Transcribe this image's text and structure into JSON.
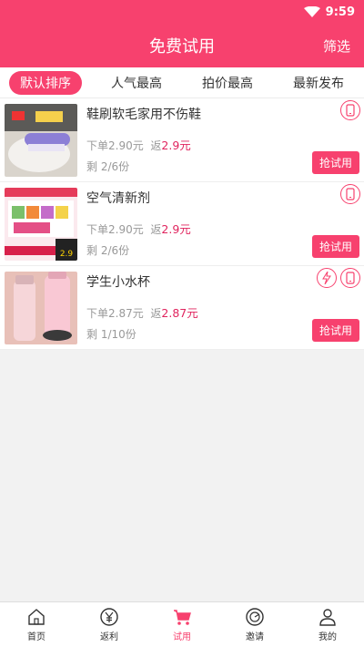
{
  "status": {
    "time": "9:59"
  },
  "header": {
    "title": "免费试用",
    "filter_label": "筛选"
  },
  "tabs": [
    {
      "label": "默认排序",
      "active": true
    },
    {
      "label": "人气最高",
      "active": false
    },
    {
      "label": "拍价最高",
      "active": false
    },
    {
      "label": "最新发布",
      "active": false
    }
  ],
  "items": [
    {
      "name": "鞋刷软毛家用不伤鞋",
      "order_price": "下单2.90元",
      "return_prefix": "返",
      "return_value": "2.9元",
      "remain": "剩 2/6份",
      "button": "抢试用",
      "badges": [
        "phone-icon"
      ]
    },
    {
      "name": "空气清新剂",
      "order_price": "下单2.90元",
      "return_prefix": "返",
      "return_value": "2.9元",
      "remain": "剩 2/6份",
      "button": "抢试用",
      "badges": [
        "phone-icon"
      ]
    },
    {
      "name": "学生小水杯",
      "order_price": "下单2.87元",
      "return_prefix": "返",
      "return_value": "2.87元",
      "remain": "剩 1/10份",
      "button": "抢试用",
      "badges": [
        "lightning-icon",
        "phone-icon"
      ]
    }
  ],
  "thumb_texts": {
    "item2_price": "2.9"
  },
  "bottom_nav": [
    {
      "label": "首页",
      "icon": "home-icon",
      "active": false
    },
    {
      "label": "返利",
      "icon": "yen-icon",
      "active": false
    },
    {
      "label": "试用",
      "icon": "cart-icon",
      "active": true
    },
    {
      "label": "邀请",
      "icon": "invite-icon",
      "active": false
    },
    {
      "label": "我的",
      "icon": "user-icon",
      "active": false
    }
  ],
  "colors": {
    "brand": "#f7416e",
    "return_price": "#e0245e"
  }
}
